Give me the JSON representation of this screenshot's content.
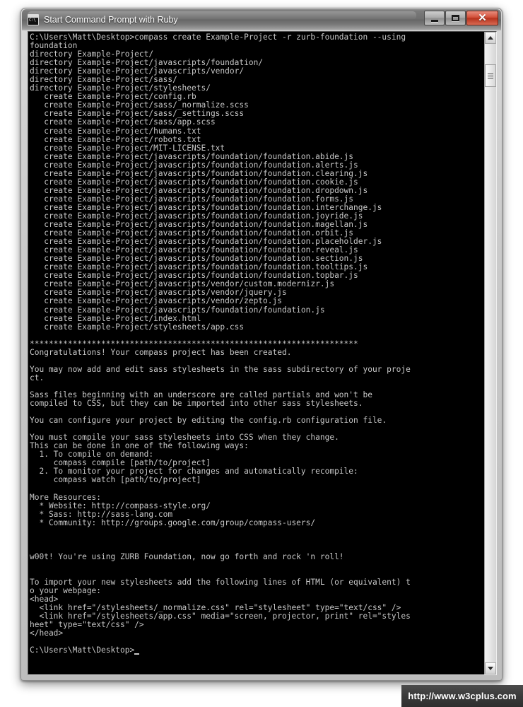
{
  "window": {
    "title": "Start Command Prompt with Ruby",
    "icon": "console-icon",
    "icon_text": "C:\\",
    "controls": {
      "minimize_label": "–",
      "maximize_label": "□",
      "close_label": "✕"
    }
  },
  "scrollbar": {
    "up_arrow": "scroll-up-arrow",
    "down_arrow": "scroll-down-arrow",
    "thumb": "scroll-thumb"
  },
  "watermark": {
    "text": "http://www.w3cplus.com"
  },
  "console": {
    "prompt_path": "C:\\Users\\Matt\\Desktop>",
    "command": "compass create Example-Project -r zurb-foundation --using foundation",
    "cursor": "block-cursor",
    "text": "C:\\Users\\Matt\\Desktop>compass create Example-Project -r zurb-foundation --using\nfoundation\ndirectory Example-Project/\ndirectory Example-Project/javascripts/foundation/\ndirectory Example-Project/javascripts/vendor/\ndirectory Example-Project/sass/\ndirectory Example-Project/stylesheets/\n   create Example-Project/config.rb\n   create Example-Project/sass/_normalize.scss\n   create Example-Project/sass/_settings.scss\n   create Example-Project/sass/app.scss\n   create Example-Project/humans.txt\n   create Example-Project/robots.txt\n   create Example-Project/MIT-LICENSE.txt\n   create Example-Project/javascripts/foundation/foundation.abide.js\n   create Example-Project/javascripts/foundation/foundation.alerts.js\n   create Example-Project/javascripts/foundation/foundation.clearing.js\n   create Example-Project/javascripts/foundation/foundation.cookie.js\n   create Example-Project/javascripts/foundation/foundation.dropdown.js\n   create Example-Project/javascripts/foundation/foundation.forms.js\n   create Example-Project/javascripts/foundation/foundation.interchange.js\n   create Example-Project/javascripts/foundation/foundation.joyride.js\n   create Example-Project/javascripts/foundation/foundation.magellan.js\n   create Example-Project/javascripts/foundation/foundation.orbit.js\n   create Example-Project/javascripts/foundation/foundation.placeholder.js\n   create Example-Project/javascripts/foundation/foundation.reveal.js\n   create Example-Project/javascripts/foundation/foundation.section.js\n   create Example-Project/javascripts/foundation/foundation.tooltips.js\n   create Example-Project/javascripts/foundation/foundation.topbar.js\n   create Example-Project/javascripts/vendor/custom.modernizr.js\n   create Example-Project/javascripts/vendor/jquery.js\n   create Example-Project/javascripts/vendor/zepto.js\n   create Example-Project/javascripts/foundation/foundation.js\n   create Example-Project/index.html\n   create Example-Project/stylesheets/app.css\n\n*********************************************************************\nCongratulations! Your compass project has been created.\n\nYou may now add and edit sass stylesheets in the sass subdirectory of your proje\nct.\n\nSass files beginning with an underscore are called partials and won't be\ncompiled to CSS, but they can be imported into other sass stylesheets.\n\nYou can configure your project by editing the config.rb configuration file.\n\nYou must compile your sass stylesheets into CSS when they change.\nThis can be done in one of the following ways:\n  1. To compile on demand:\n     compass compile [path/to/project]\n  2. To monitor your project for changes and automatically recompile:\n     compass watch [path/to/project]\n\nMore Resources:\n  * Website: http://compass-style.org/\n  * Sass: http://sass-lang.com\n  * Community: http://groups.google.com/group/compass-users/\n\n\n\nw00t! You're using ZURB Foundation, now go forth and rock 'n roll!\n\n\nTo import your new stylesheets add the following lines of HTML (or equivalent) t\no your webpage:\n<head>\n  <link href=\"/stylesheets/_normalize.css\" rel=\"stylesheet\" type=\"text/css\" />\n  <link href=\"/stylesheets/app.css\" media=\"screen, projector, print\" rel=\"styles\nheet\" type=\"text/css\" />\n</head>\n\nC:\\Users\\Matt\\Desktop>"
  }
}
